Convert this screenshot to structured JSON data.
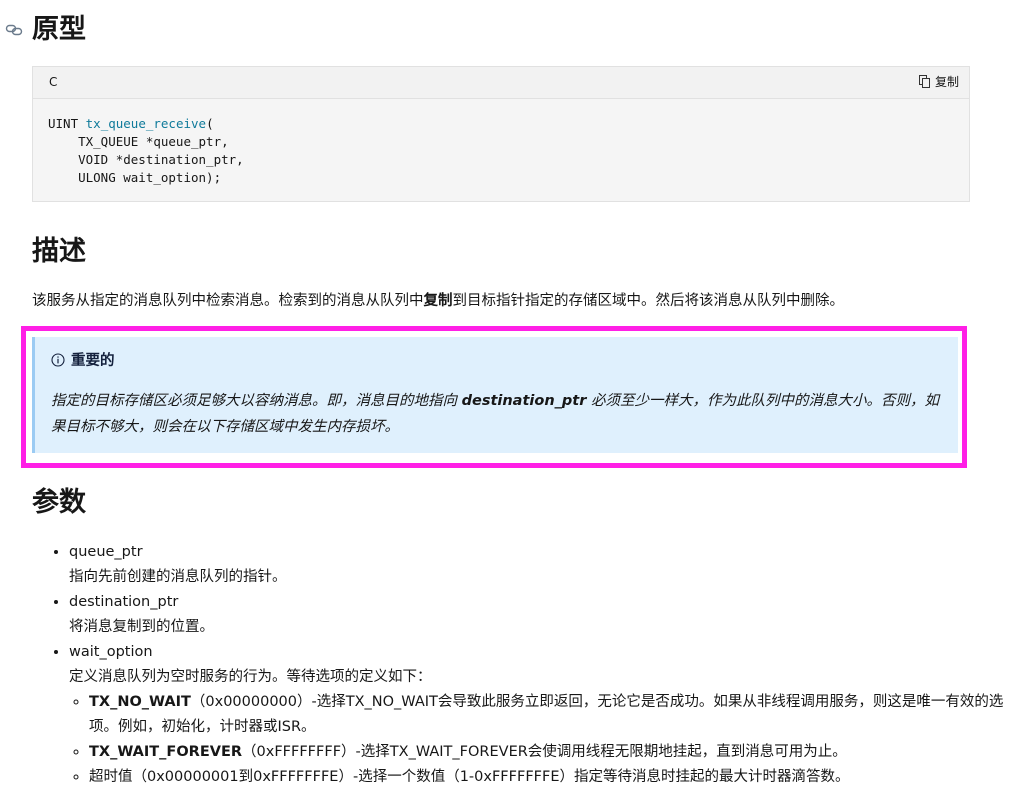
{
  "prototype": {
    "heading": "原型",
    "code_lang": "C",
    "copy_label": "复制",
    "code_lines": [
      {
        "pre": "UINT ",
        "fn": "tx_queue_receive",
        "post": "("
      },
      {
        "pre": "    TX_QUEUE *queue_ptr,"
      },
      {
        "pre": "    VOID *destination_ptr,"
      },
      {
        "pre": "    ULONG wait_option);"
      }
    ]
  },
  "description": {
    "heading": "描述",
    "p_before": "该服务从指定的消息队列中检索消息。检索到的消息从队列中",
    "p_bold": "复制",
    "p_after": "到目标指针指定的存储区域中。然后将该消息从队列中删除。"
  },
  "important": {
    "title": "重要的",
    "body_before": "指定的目标存储区必须足够大以容纳消息。即，消息目的地指向 ",
    "body_bold": "destination_ptr",
    "body_after": " 必须至少一样大，作为此队列中的消息大小。否则，如果目标不够大，则会在以下存储区域中发生内存损坏。"
  },
  "parameters": {
    "heading": "参数",
    "items": [
      {
        "name": "queue_ptr",
        "desc": "指向先前创建的消息队列的指针。"
      },
      {
        "name": "destination_ptr",
        "desc": "将消息复制到的位置。"
      },
      {
        "name": "wait_option",
        "desc": "定义消息队列为空时服务的行为。等待选项的定义如下："
      }
    ],
    "wait_options": [
      {
        "bold": "TX_NO_WAIT",
        "text": "（0x00000000）-选择TX_NO_WAIT会导致此服务立即返回，无论它是否成功。如果从非线程调用服务，则这是唯一有效的选项。例如，初始化，计时器或ISR。"
      },
      {
        "bold": "TX_WAIT_FOREVER",
        "text": "（0xFFFFFFFF）-选择TX_WAIT_FOREVER会使调用线程无限期地挂起，直到消息可用为止。"
      },
      {
        "bold": "",
        "text": "超时值（0x00000001到0xFFFFFFFE）-选择一个数值（1-0xFFFFFFFE）指定等待消息时挂起的最大计时器滴答数。"
      }
    ]
  },
  "colors": {
    "highlight_outline": "#ff1fe6",
    "alert_bg": "#dff0fd",
    "code_fn": "#0f7a9a"
  }
}
